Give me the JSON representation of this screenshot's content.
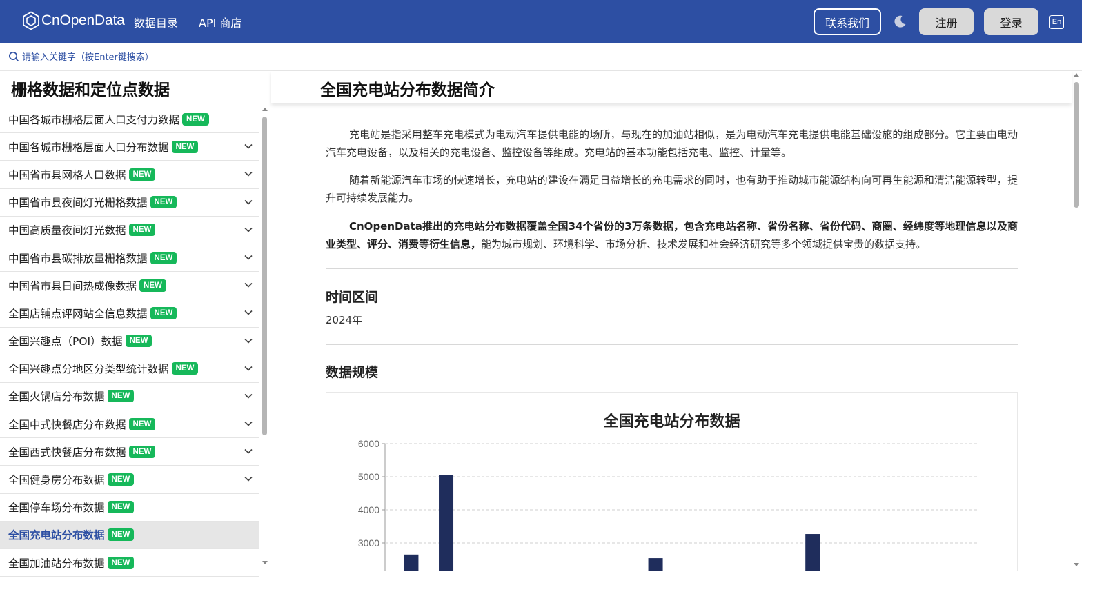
{
  "header": {
    "brand": "CnOpenData",
    "nav": [
      "数据目录",
      "API 商店"
    ],
    "contact_label": "联系我们",
    "register_label": "注册",
    "login_label": "登录",
    "lang_label": "En",
    "bg_color": "#2d4fa3"
  },
  "search": {
    "placeholder": "请输入关键字（按Enter键搜索）"
  },
  "sidebar": {
    "title": "栅格数据和定位点数据",
    "badge": "NEW",
    "items": [
      {
        "label": "中国各城市栅格层面人口支付力数据",
        "expandable": false,
        "active": false
      },
      {
        "label": "中国各城市栅格层面人口分布数据",
        "expandable": true,
        "active": false
      },
      {
        "label": "中国省市县网格人口数据",
        "expandable": true,
        "active": false
      },
      {
        "label": "中国省市县夜间灯光栅格数据",
        "expandable": true,
        "active": false
      },
      {
        "label": "中国高质量夜间灯光数据",
        "expandable": true,
        "active": false
      },
      {
        "label": "中国省市县碳排放量栅格数据",
        "expandable": true,
        "active": false
      },
      {
        "label": "中国省市县日间热成像数据",
        "expandable": true,
        "active": false
      },
      {
        "label": "全国店铺点评网站全信息数据",
        "expandable": true,
        "active": false
      },
      {
        "label": "全国兴趣点（POI）数据",
        "expandable": true,
        "active": false
      },
      {
        "label": "全国兴趣点分地区分类型统计数据",
        "expandable": true,
        "active": false
      },
      {
        "label": "全国火锅店分布数据",
        "expandable": true,
        "active": false
      },
      {
        "label": "全国中式快餐店分布数据",
        "expandable": true,
        "active": false
      },
      {
        "label": "全国西式快餐店分布数据",
        "expandable": true,
        "active": false
      },
      {
        "label": "全国健身房分布数据",
        "expandable": true,
        "active": false
      },
      {
        "label": "全国停车场分布数据",
        "expandable": false,
        "active": false
      },
      {
        "label": "全国充电站分布数据",
        "expandable": false,
        "active": true
      },
      {
        "label": "全国加油站分布数据",
        "expandable": false,
        "active": false
      }
    ]
  },
  "main": {
    "title": "全国充电站分布数据简介",
    "para1": "充电站是指采用整车充电模式为电动汽车提供电能的场所，与现在的加油站相似，是为电动汽车充电提供电能基础设施的组成部分。它主要由电动汽车充电设备，以及相关的充电设备、监控设备等组成。充电站的基本功能包括充电、监控、计量等。",
    "para2": "随着新能源汽车市场的快速增长，充电站的建设在满足日益增长的充电需求的同时，也有助于推动城市能源结构向可再生能源和清洁能源转型，提升可持续发展能力。",
    "para3_bold": "CnOpenData推出的充电站分布数据覆盖全国34个省份的3万条数据，包含充电站名称、省份名称、省份代码、商圈、经纬度等地理信息以及商业类型、评分、消费等衍生信息，",
    "para3_rest": "能为城市规划、环境科学、市场分析、技术发展和社会经济研究等多个领域提供宝贵的数据支持。",
    "time_title": "时间区间",
    "time_value": "2024年",
    "scale_title": "数据规模"
  },
  "chart_data": {
    "type": "bar",
    "title": "全国充电站分布数据",
    "ylim": [
      0,
      6000
    ],
    "yticks": [
      6000,
      5000,
      4000,
      3000
    ],
    "grid": true,
    "bar_color": "#1f2d5c",
    "categories": [
      "",
      "",
      "",
      "",
      "",
      "",
      "",
      "",
      "",
      "",
      "",
      "",
      "",
      "",
      "",
      "",
      "",
      "",
      "",
      "",
      "",
      "",
      "",
      "",
      "",
      "",
      "",
      "",
      "",
      "",
      "",
      "",
      "",
      ""
    ],
    "values": [
      null,
      2650,
      null,
      5050,
      null,
      null,
      null,
      null,
      null,
      null,
      null,
      null,
      null,
      null,
      null,
      2540,
      null,
      null,
      null,
      null,
      null,
      null,
      null,
      null,
      3270,
      null,
      null,
      null,
      null,
      null,
      null,
      null,
      null,
      null
    ]
  }
}
